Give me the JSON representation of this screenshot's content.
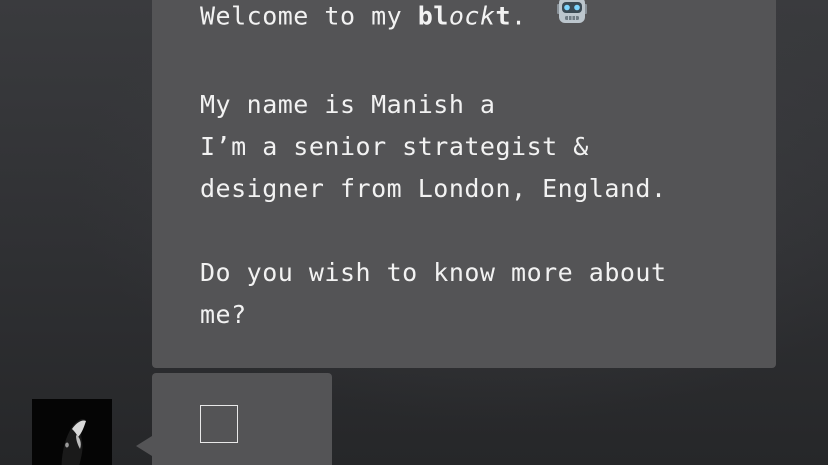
{
  "intro": {
    "welcome_prefix": "Welcome to my ",
    "brand_b": "bl",
    "brand_italic": "ock",
    "brand_t": "t",
    "welcome_suffix": ".",
    "robot_icon": "robot-face-icon",
    "name_line": "My name is Manish a",
    "role_line_1": "I’m a senior strategist &",
    "role_line_2": "designer from London, England.",
    "question_line_1": "Do you wish to know more about",
    "question_line_2": "me?"
  },
  "reply": {
    "checkbox_checked": false
  },
  "colors": {
    "bubble": "#545456",
    "text": "#f2f2f2",
    "background": "#2f3033"
  }
}
